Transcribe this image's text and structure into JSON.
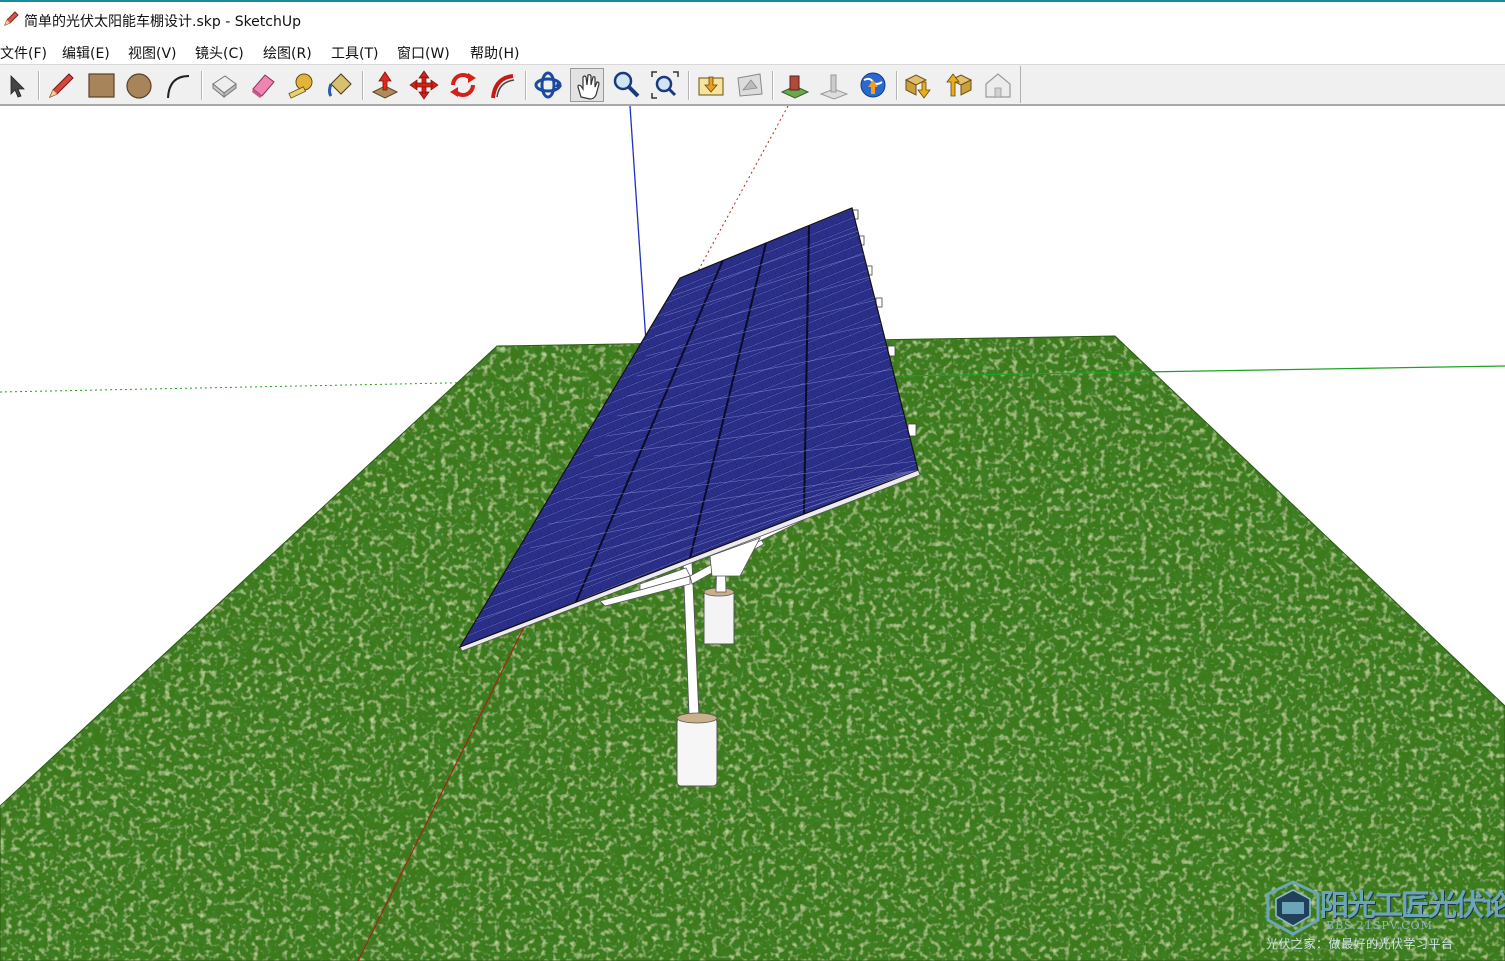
{
  "window": {
    "title": "简单的光伏太阳能车棚设计.skp - SketchUp",
    "app_icon": "sketchup-pencil-icon"
  },
  "menu": {
    "items": [
      {
        "label": "文件(F)"
      },
      {
        "label": "编辑(E)"
      },
      {
        "label": "视图(V)"
      },
      {
        "label": "镜头(C)"
      },
      {
        "label": "绘图(R)"
      },
      {
        "label": "工具(T)"
      },
      {
        "label": "窗口(W)"
      },
      {
        "label": "帮助(H)"
      }
    ]
  },
  "toolbar": {
    "tools": [
      {
        "name": "select",
        "icon": "arrow-cursor-icon"
      },
      {
        "name": "pencil",
        "icon": "pencil-icon"
      },
      {
        "name": "rectangle",
        "icon": "rectangle-icon"
      },
      {
        "name": "circle",
        "icon": "circle-icon"
      },
      {
        "name": "arc",
        "icon": "arc-icon"
      },
      {
        "name": "make-component",
        "icon": "component-icon"
      },
      {
        "name": "eraser",
        "icon": "eraser-icon"
      },
      {
        "name": "tape-measure",
        "icon": "tape-measure-icon"
      },
      {
        "name": "paint-bucket",
        "icon": "paint-bucket-icon"
      },
      {
        "name": "push-pull",
        "icon": "push-pull-icon"
      },
      {
        "name": "move",
        "icon": "move-icon"
      },
      {
        "name": "rotate",
        "icon": "rotate-icon"
      },
      {
        "name": "follow-me",
        "icon": "follow-me-icon"
      },
      {
        "name": "orbit",
        "icon": "orbit-icon"
      },
      {
        "name": "pan",
        "icon": "pan-hand-icon",
        "active": true
      },
      {
        "name": "zoom",
        "icon": "zoom-icon"
      },
      {
        "name": "zoom-extents",
        "icon": "zoom-extents-icon"
      },
      {
        "name": "get-models",
        "icon": "get-models-icon"
      },
      {
        "name": "share-model",
        "icon": "share-model-icon"
      },
      {
        "name": "add-location",
        "icon": "add-location-icon"
      },
      {
        "name": "toggle-terrain",
        "icon": "toggle-terrain-icon"
      },
      {
        "name": "preview-in-earth",
        "icon": "earth-globe-icon"
      },
      {
        "name": "get-component",
        "icon": "component-download-icon"
      },
      {
        "name": "share-component",
        "icon": "component-upload-icon"
      },
      {
        "name": "extension-warehouse",
        "icon": "extension-house-icon"
      }
    ]
  },
  "scene": {
    "ground": "grass-textured-plane",
    "model": "single-post-pv-tracker-array",
    "axes": {
      "red": "#c0201a",
      "green": "#1fa21f",
      "blue": "#2030c0"
    },
    "colors": {
      "grass": "#3c7a1e",
      "panel": "#23257a",
      "structure": "#ffffff"
    }
  },
  "watermark": {
    "brand": "阳光工匠光伏论坛",
    "url": "BBS.21SPV.COM",
    "slogan": "光伏之家：做最好的光伏学习平台"
  }
}
